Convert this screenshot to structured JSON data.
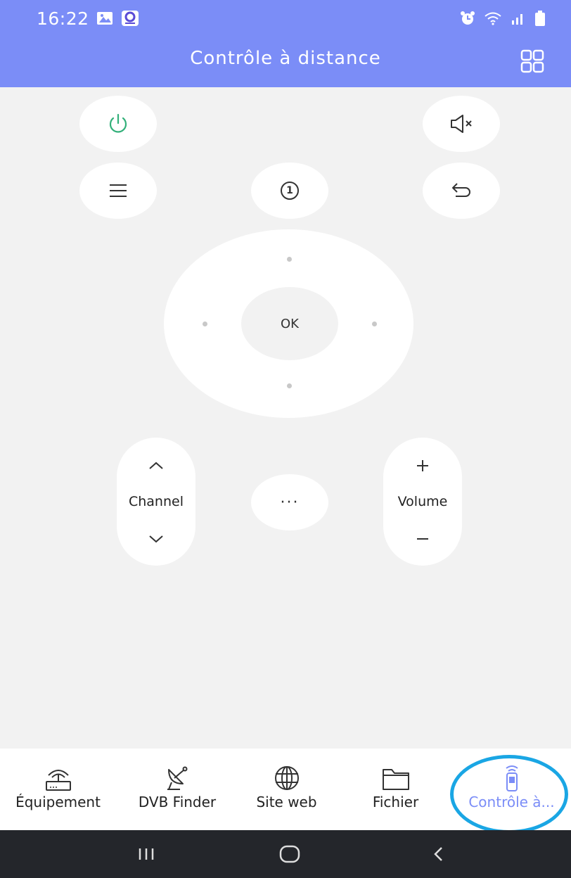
{
  "status_bar": {
    "time": "16:22",
    "left_icons": [
      "image-notification-icon",
      "app-notification-icon"
    ],
    "right_icons": [
      "alarm-icon",
      "wifi-icon",
      "signal-icon",
      "battery-icon"
    ]
  },
  "app_bar": {
    "title": "Contrôle à distance",
    "grid_icon": "grid-icon"
  },
  "remote": {
    "power_icon": "power-icon",
    "mute_icon": "mute-icon",
    "menu_icon": "menu-icon",
    "number_label": "1",
    "back_icon": "back-icon",
    "ok_label": "OK",
    "channel_label": "Channel",
    "volume_label": "Volume",
    "more_label": "···"
  },
  "bottom_nav": {
    "items": [
      {
        "label": "Équipement",
        "icon": "router-icon"
      },
      {
        "label": "DVB Finder",
        "icon": "satellite-icon"
      },
      {
        "label": "Site web",
        "icon": "globe-icon"
      },
      {
        "label": "Fichier",
        "icon": "folder-icon"
      },
      {
        "label": "Contrôle à...",
        "icon": "remote-control-icon"
      }
    ],
    "active_index": 4
  },
  "colors": {
    "brand": "#7b8df7",
    "power_green": "#33b07a",
    "highlight_ring": "#1aa6e4",
    "system_nav": "#24262b"
  }
}
